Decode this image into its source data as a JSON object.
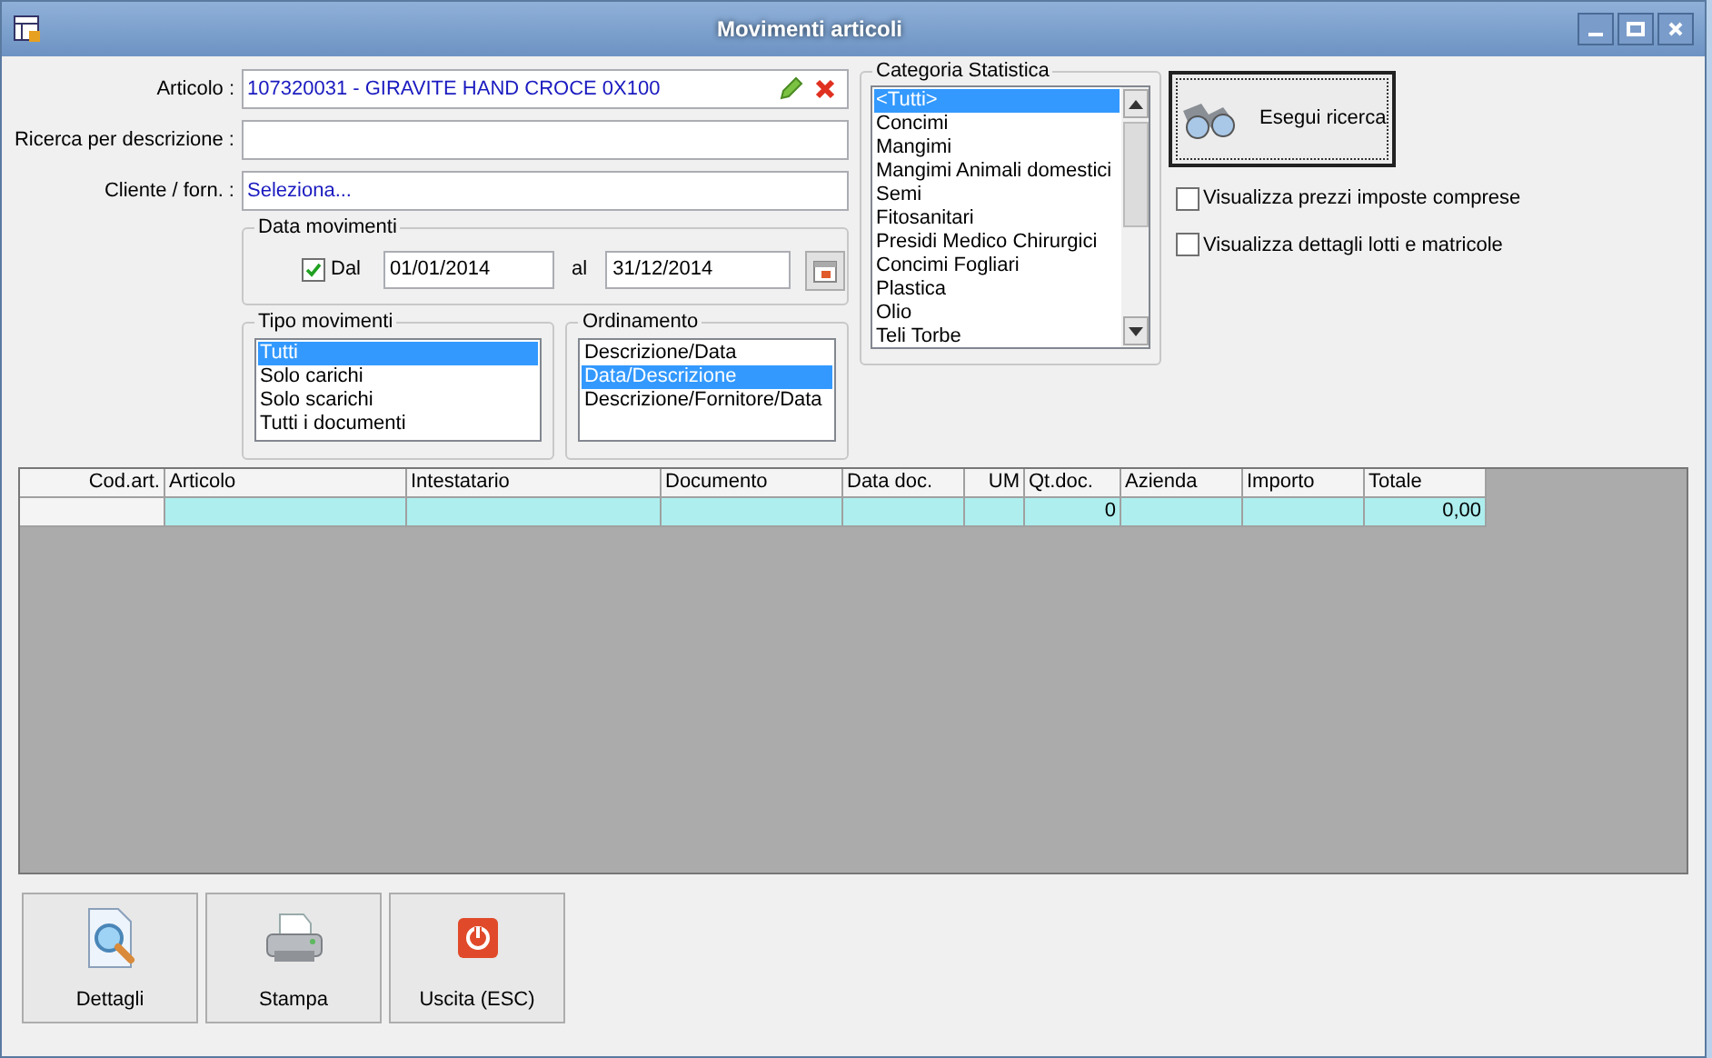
{
  "window": {
    "title": "Movimenti articoli"
  },
  "fields": [
    {
      "label": "Articolo :",
      "value": "107320031 - GIRAVITE HAND CROCE 0X100",
      "kind": "article"
    },
    {
      "label": "Ricerca per descrizione :",
      "kind": "text"
    },
    {
      "label": "Cliente / forn. :",
      "value": "Seleziona...",
      "kind": "select"
    }
  ],
  "date_range": {
    "title": "Data movimenti",
    "checkbox": {
      "label": "Dal",
      "checked": true
    },
    "from": "01/01/2014",
    "to_label": "al",
    "to": "31/12/2014"
  },
  "tipo_movimenti": {
    "title": "Tipo movimenti",
    "items": [
      {
        "label": "Tutti",
        "selected": true
      },
      {
        "label": "Solo carichi",
        "selected": false
      },
      {
        "label": "Solo scarichi",
        "selected": false
      },
      {
        "label": "Tutti i documenti",
        "selected": false
      }
    ]
  },
  "ordinamento": {
    "title": "Ordinamento",
    "items": [
      {
        "label": "Descrizione/Data",
        "selected": false
      },
      {
        "label": "Data/Descrizione",
        "selected": true
      },
      {
        "label": "Descrizione/Fornitore/Data",
        "selected": false
      }
    ]
  },
  "categoria": {
    "title": "Categoria Statistica",
    "items": [
      {
        "label": "<Tutti>",
        "selected": true
      },
      {
        "label": "Concimi",
        "selected": false
      },
      {
        "label": "Mangimi",
        "selected": false
      },
      {
        "label": "Mangimi Animali domestici",
        "selected": false
      },
      {
        "label": "Semi",
        "selected": false
      },
      {
        "label": "Fitosanitari",
        "selected": false
      },
      {
        "label": "Presidi Medico Chirurgici",
        "selected": false
      },
      {
        "label": "Concimi Fogliari",
        "selected": false
      },
      {
        "label": "Plastica",
        "selected": false
      },
      {
        "label": "Olio",
        "selected": false
      },
      {
        "label": "Teli Torbe",
        "selected": false
      }
    ]
  },
  "search_button": {
    "label": "Esegui ricerca"
  },
  "options": [
    {
      "label": "Visualizza prezzi imposte comprese",
      "checked": false
    },
    {
      "label": "Visualizza dettagli lotti e matricole",
      "checked": false
    }
  ],
  "table": {
    "columns": [
      {
        "label": "Cod.art.",
        "kind": "code"
      },
      {
        "label": "Articolo",
        "kind": "text"
      },
      {
        "label": "Intestatario",
        "kind": "text"
      },
      {
        "label": "Documento",
        "kind": "text"
      },
      {
        "label": "Data doc.",
        "kind": "text"
      },
      {
        "label": "UM",
        "kind": "unit"
      },
      {
        "label": "Qt.doc.",
        "kind": "number"
      },
      {
        "label": "Azienda",
        "kind": "text"
      },
      {
        "label": "Importo",
        "kind": "number"
      },
      {
        "label": "Totale",
        "kind": "number"
      }
    ],
    "rows": [
      {
        "selected": true,
        "cells": [
          null,
          null,
          null,
          null,
          null,
          null,
          "0",
          null,
          null,
          "0,00"
        ]
      }
    ]
  },
  "buttons": [
    {
      "label": "Dettagli",
      "kind": "details"
    },
    {
      "label": "Stampa",
      "kind": "print"
    },
    {
      "label": "Uscita (ESC)",
      "kind": "exit"
    }
  ]
}
